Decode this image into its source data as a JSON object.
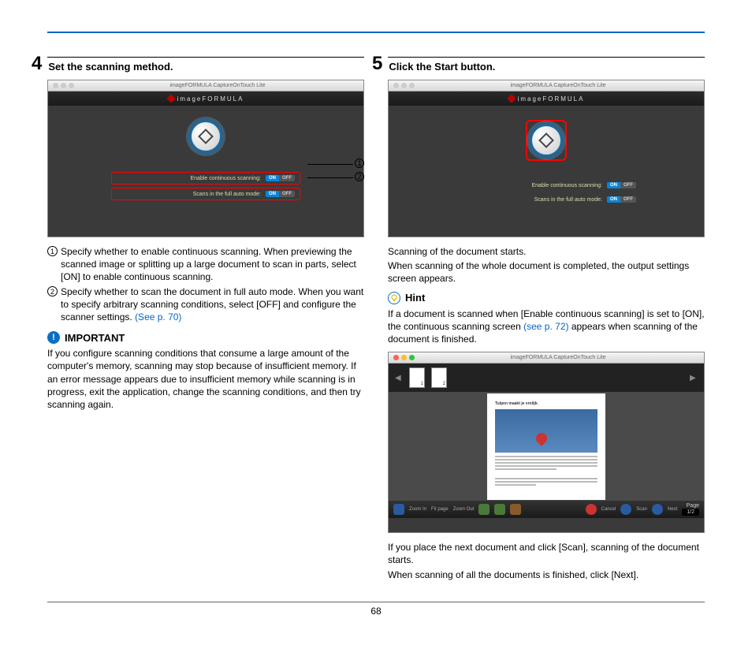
{
  "page_number": "68",
  "left": {
    "step_num": "4",
    "step_title": "Set the scanning method.",
    "screenshot": {
      "titlebar": "imageFORMULA CaptureOnTouch Lite",
      "brand": "imageFORMULA",
      "opt1_label": "Enable continuous scanning:",
      "opt2_label": "Scans in the full auto mode:",
      "on": "ON",
      "off": "OFF",
      "callout1": "1",
      "callout2": "2"
    },
    "item1_num": "1",
    "item1_text": "Specify whether to enable continuous scanning. When previewing the scanned image or splitting up a large document to scan in parts, select [ON] to enable continuous scanning.",
    "item2_num": "2",
    "item2_text_a": "Specify whether to scan the document in full auto mode. When you want to specify arbitrary scanning conditions, select [OFF] and configure the scanner settings. ",
    "item2_link": "(See p. 70)",
    "important_label": "IMPORTANT",
    "important_text": "If you configure scanning conditions that consume a large amount of the computer's memory, scanning may stop because of insufficient memory. If an error message appears due to insufficient memory while scanning is in progress, exit the application, change the scanning conditions, and then try scanning again."
  },
  "right": {
    "step_num": "5",
    "step_title": "Click the Start button.",
    "screenshot_a": {
      "titlebar": "imageFORMULA CaptureOnTouch Lite",
      "brand": "imageFORMULA",
      "opt1_label": "Enable continuous scanning:",
      "opt2_label": "Scans in the full auto mode:",
      "on": "ON",
      "off": "OFF"
    },
    "text1": "Scanning of the document starts.",
    "text2": "When scanning of the whole document is completed, the output settings screen appears.",
    "hint_label": "Hint",
    "hint_text_a": "If a document is scanned when [Enable continuous scanning] is set to [ON], the continuous scanning screen ",
    "hint_link": "(see p. 72)",
    "hint_text_b": " appears when scanning of the document is finished.",
    "screenshot_b": {
      "titlebar": "imageFORMULA CaptureOnTouch Lite",
      "thumb1": "1",
      "thumb2": "2",
      "toolbar": {
        "zoom_in": "Zoom In",
        "fit": "Fit page",
        "zoom_out": "Zoom Out",
        "rotate_l": "Rotate left",
        "rotate_r": "Rotate right",
        "delete": "Delete DEL",
        "cancel": "Cancel",
        "scan": "Scan",
        "next": "Next",
        "page_label": "Page",
        "page_value": "1/2"
      }
    },
    "text3": "If you place the next document and click [Scan], scanning of the document starts.",
    "text4": "When scanning of all the documents is finished, click [Next]."
  }
}
